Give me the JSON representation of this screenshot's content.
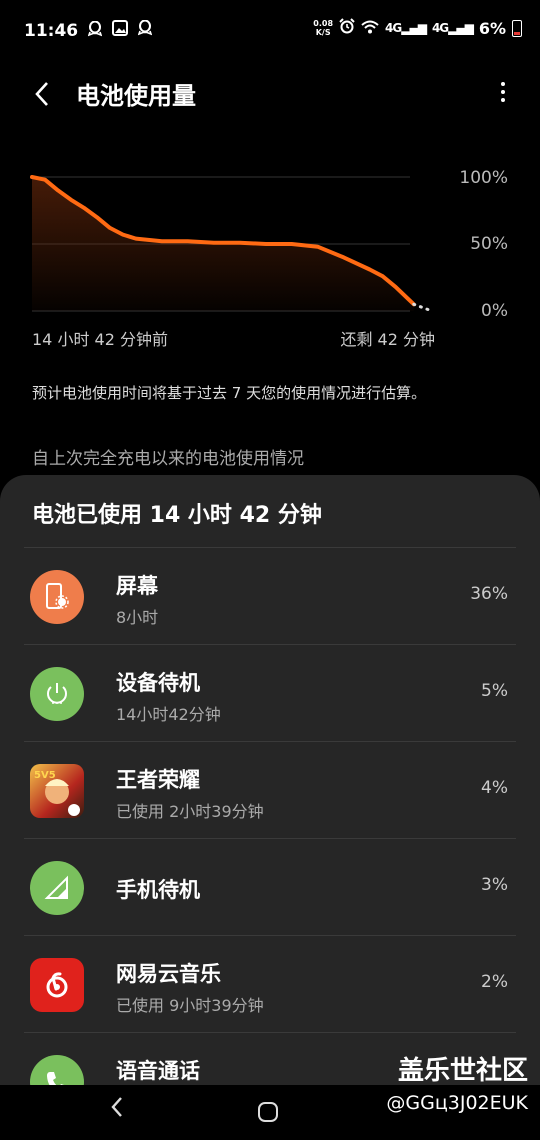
{
  "status": {
    "time": "11:46",
    "net_speed_top": "0.08",
    "net_speed_bottom": "K/S",
    "battery_pct": "6%"
  },
  "header": {
    "title": "电池使用量"
  },
  "chart": {
    "y_labels": [
      "100%",
      "50%",
      "0%"
    ],
    "x_start_label": "14 小时 42 分钟前",
    "x_end_label": "还剩 42 分钟",
    "line_color": "#ff6a13"
  },
  "chart_data": {
    "type": "area",
    "title": "",
    "xlabel": "",
    "ylabel": "",
    "x_labels": [
      "14 小时 42 分钟前",
      "还剩 42 分钟"
    ],
    "ylim": [
      0,
      100
    ],
    "series": [
      {
        "values": [
          [
            0,
            100
          ],
          [
            0.5,
            98
          ],
          [
            1,
            90
          ],
          [
            1.5,
            83
          ],
          [
            2,
            77
          ],
          [
            2.5,
            70
          ],
          [
            3,
            62
          ],
          [
            3.5,
            57
          ],
          [
            4,
            54
          ],
          [
            5,
            52
          ],
          [
            6,
            52
          ],
          [
            7,
            51
          ],
          [
            8,
            51
          ],
          [
            9,
            50
          ],
          [
            10,
            50
          ],
          [
            11,
            48
          ],
          [
            12,
            40
          ],
          [
            13,
            31
          ],
          [
            13.5,
            26
          ],
          [
            14,
            18
          ],
          [
            14.7,
            5
          ]
        ]
      }
    ],
    "projection": [
      [
        14.7,
        5
      ],
      [
        15.4,
        0
      ]
    ]
  },
  "info": {
    "note": "预计电池使用时间将基于过去 7 天您的使用情况进行估算。",
    "section_title": "自上次完全充电以来的电池使用情况"
  },
  "usage": {
    "title": "电池已使用 14 小时 42 分钟",
    "items": [
      {
        "name": "屏幕",
        "sub": "8小时",
        "pct": "36%",
        "icon": "screen-icon",
        "color": "#ef7d4b"
      },
      {
        "name": "设备待机",
        "sub": "14小时42分钟",
        "pct": "5%",
        "icon": "power-icon",
        "color": "#7ac05d"
      },
      {
        "name": "王者荣耀",
        "sub": "已使用 2小时39分钟",
        "pct": "4%",
        "icon": "game-icon",
        "color": "#c0392b"
      },
      {
        "name": "手机待机",
        "sub": "",
        "pct": "3%",
        "icon": "signal-icon",
        "color": "#7ac05d"
      },
      {
        "name": "网易云音乐",
        "sub": "已使用 9小时39分钟",
        "pct": "2%",
        "icon": "netease-music-icon",
        "color": "#e0221c"
      },
      {
        "name": "语音通话",
        "sub": "",
        "pct": "",
        "icon": "phone-icon",
        "color": "#7ac05d"
      }
    ]
  },
  "watermark": {
    "line1": "盖乐世社区",
    "line2": "@GGц3J02EUK"
  }
}
